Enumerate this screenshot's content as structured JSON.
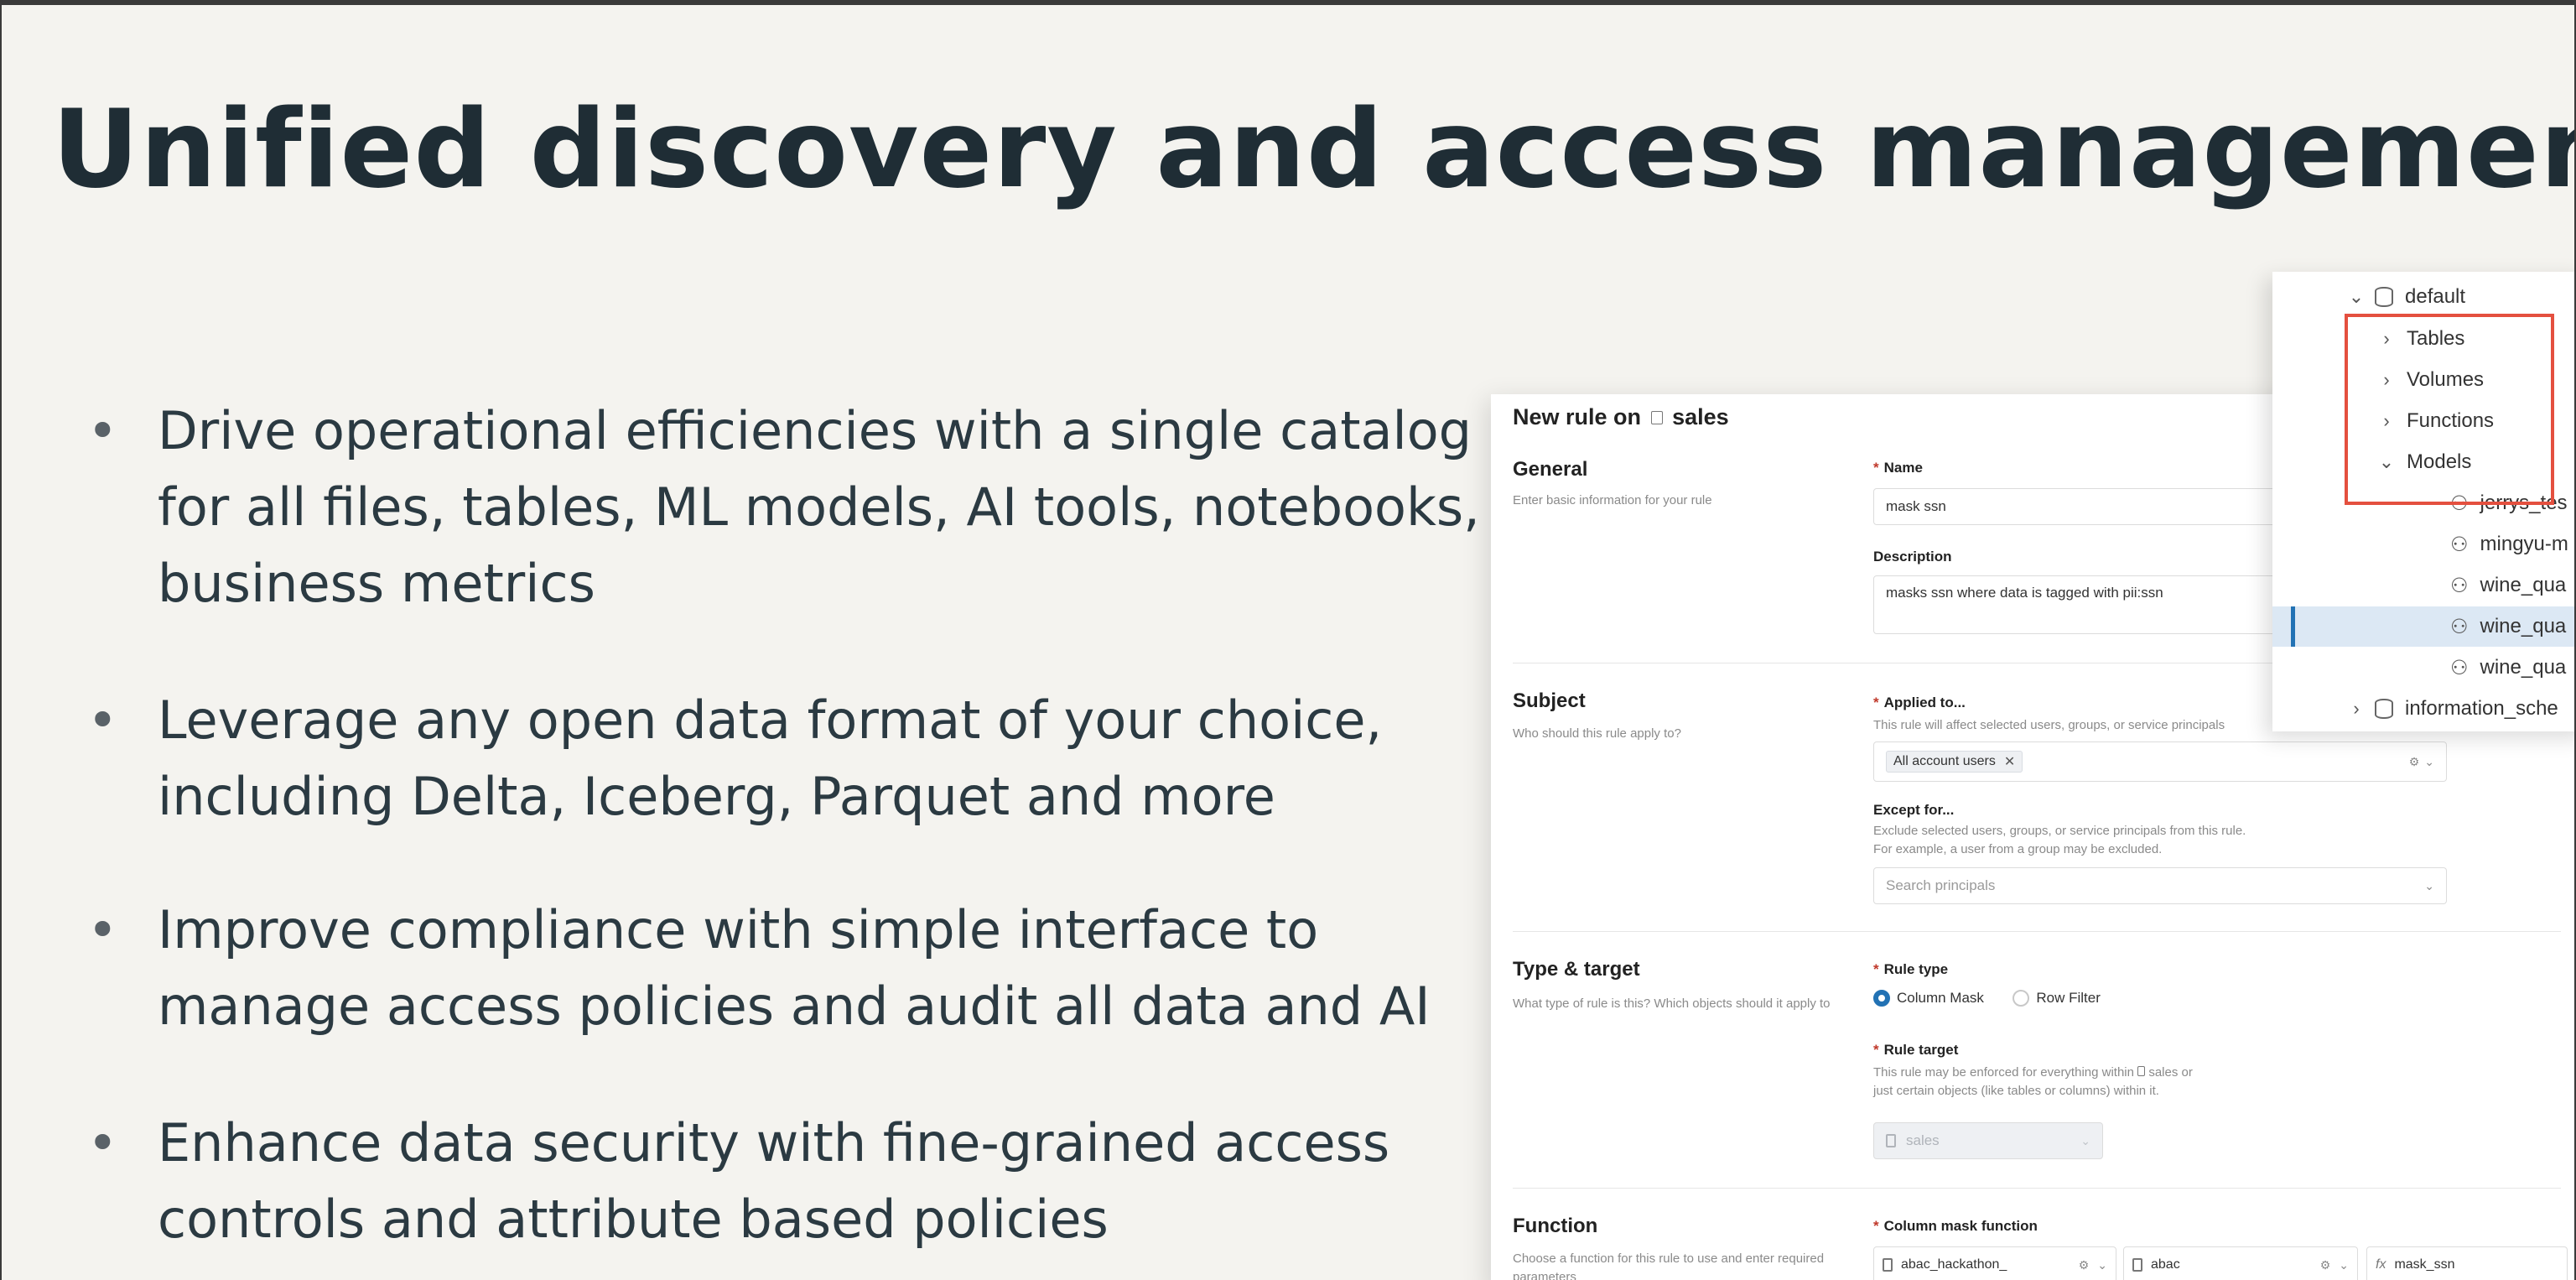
{
  "slide": {
    "title": "Unified discovery and access management",
    "bullets": [
      "Drive operational efficiencies with a single catalog for all files, tables, ML models, AI tools, notebooks, business metrics",
      "Leverage any open data format of your choice, including Delta, Iceberg, Parquet and more",
      "Improve compliance with simple interface to manage access policies and audit all data and AI",
      "Enhance data security with fine-grained access controls and attribute based policies"
    ]
  },
  "form": {
    "title_prefix": "New rule on",
    "title_catalog": "sales",
    "general": {
      "title": "General",
      "desc": "Enter basic information for your rule",
      "name_label": "Name",
      "name_value": "mask ssn",
      "description_label": "Description",
      "description_value": "masks ssn where data is tagged with pii:ssn"
    },
    "subject": {
      "title": "Subject",
      "desc": "Who should this rule apply to?",
      "applied_label": "Applied to...",
      "applied_help": "This rule will affect selected users, groups, or service principals",
      "applied_chip": "All account users",
      "except_label": "Except for...",
      "except_help_1": "Exclude selected users, groups, or service principals from this rule.",
      "except_help_2": "For example, a user from a group may be excluded.",
      "search_placeholder": "Search principals"
    },
    "type_target": {
      "title": "Type & target",
      "desc": "What type of rule is this? Which objects should it apply to",
      "rule_type_label": "Rule type",
      "option_column_mask": "Column Mask",
      "option_row_filter": "Row Filter",
      "rule_target_label": "Rule target",
      "rule_target_help_1": "This rule may be enforced for everything within",
      "rule_target_help_catalog": "sales or",
      "rule_target_help_2": "just certain objects (like tables or columns) within it.",
      "target_value": "sales"
    },
    "function": {
      "title": "Function",
      "desc": "Choose a function for this rule to use and enter required parameters",
      "mask_label": "Column mask function",
      "catalog_value": "abac_hackathon_",
      "schema_value": "abac",
      "function_value": "mask_ssn",
      "fx": "fx"
    }
  },
  "tree": {
    "items": [
      {
        "label": "default",
        "chevron": "⌄",
        "icon": "database-icon"
      },
      {
        "label": "Tables",
        "chevron": "›",
        "icon": ""
      },
      {
        "label": "Volumes",
        "chevron": "›",
        "icon": ""
      },
      {
        "label": "Functions",
        "chevron": "›",
        "icon": ""
      },
      {
        "label": "Models",
        "chevron": "⌄",
        "icon": ""
      },
      {
        "label": "jerrys_tes",
        "icon": "model-icon"
      },
      {
        "label": "mingyu-m",
        "icon": "model-icon"
      },
      {
        "label": "wine_qua",
        "icon": "model-icon"
      },
      {
        "label": "wine_qua",
        "icon": "model-icon"
      },
      {
        "label": "wine_qua",
        "icon": "model-icon"
      },
      {
        "label": "information_sche",
        "chevron": "›",
        "icon": "database-icon"
      }
    ],
    "highlight_color": "#e4503f",
    "selected_color": "#dce8f4"
  }
}
